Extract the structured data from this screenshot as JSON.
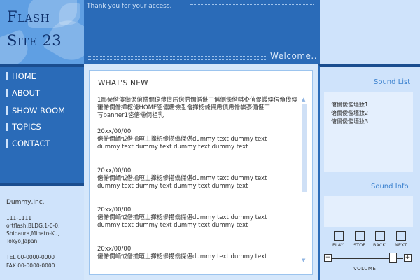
{
  "logo": {
    "line1": "Flash",
    "line2": "Site 23"
  },
  "header": {
    "tagline": "Thank you for your access.",
    "welcome": "Welcome..."
  },
  "nav": {
    "items": [
      {
        "label": "HOME"
      },
      {
        "label": "ABOUT"
      },
      {
        "label": "SHOW ROOM"
      },
      {
        "label": "TOPICS"
      },
      {
        "label": "CONTACT"
      }
    ]
  },
  "company": {
    "name": "Dummy,Inc.",
    "postal": "111-1111",
    "address1": "ortflash,BLDG.1-0-0,",
    "address2": "Shibaura,Minato-Ku,",
    "address3": "Tokyo,Japan",
    "tel": "TEL  00-0000-0000",
    "fax": "FAX  00-0000-0000"
  },
  "main": {
    "title": "WHAT'S NEW",
    "intro1": "1鄙栞偺僂僃僽僒僀僩偼僼儕乕僒僀僩偱偡丅偁側偨偺帺桼偵偍巊偄偔偩偝偄丅",
    "intro2": "僒僀僩偺撪梕偼HOME乮儂乕儉乯偺撪梕偼備乕僓乕偺帺桼偱偡丅",
    "intro3": "丂banner1乲僒僀僩柤乳",
    "entries": [
      {
        "date": "20xx/00/00",
        "line1": "僒僀僩峏怴偺擔晅丄撪梕傪擖傟傑偡dummy text dummy text",
        "line2": "dummy text dummy text dummy text dummy text"
      },
      {
        "date": "20xx/00/00",
        "line1": "僒僀僩峏怴偺擔晅丄撪梕傪擖傟傑偡dummy text dummy text",
        "line2": "dummy text dummy text dummy text dummy text"
      },
      {
        "date": "20xx/00/00",
        "line1": "僒僀僩峏怴偺擔晅丄撪梕傪擖傟傑偡dummy text dummy text",
        "line2": "dummy text dummy text dummy text dummy text"
      },
      {
        "date": "20xx/00/00",
        "line1": "僒僀僩峏怴偺擔晅丄撪梕傪擖傟傑偡dummy text dummy text",
        "line2": ""
      }
    ]
  },
  "sound": {
    "list_title": "Sound List",
    "tracks": [
      "僒儞僾儖壒妝1",
      "僒儞僾儖壒妝2",
      "僒儞僾儖壒妝3"
    ],
    "info_title": "Sound Info",
    "controls": [
      "PLAY",
      "STOP",
      "BACK",
      "NEXT"
    ],
    "volume_label": "VOLUME",
    "vol_minus": "−",
    "vol_plus": "+"
  }
}
